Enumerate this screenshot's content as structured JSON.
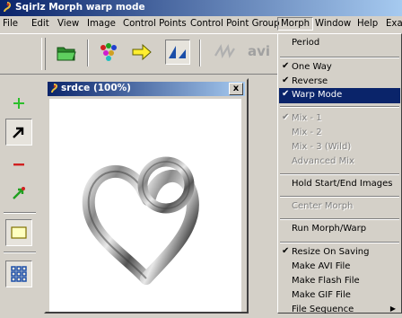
{
  "window": {
    "title": "Sqirlz Morph   warp mode"
  },
  "menubar": {
    "items": [
      "File",
      "Edit",
      "View",
      "Image",
      "Control Points",
      "Control Point Group",
      "Morph",
      "Window",
      "Help",
      "Exa"
    ],
    "open_item": "Morph"
  },
  "toolbar": {
    "buttons": [
      "open-folder-icon",
      "color-dots-icon",
      "arrow-right-icon",
      "warp-mode-icon",
      "wave-icon"
    ],
    "avi_label": "avi"
  },
  "left_tools": [
    "add-point-icon",
    "select-arrow-icon",
    "remove-point-icon",
    "move-point-icon",
    "rectangle-select-icon",
    "grid-icon"
  ],
  "child_window": {
    "title": "srdce (100%)",
    "close_label": "x",
    "image": "silver heart with ring"
  },
  "morph_menu": {
    "items": [
      {
        "label": "Period",
        "checked": false,
        "disabled": false
      },
      {
        "label": "One Way",
        "checked": true,
        "disabled": false
      },
      {
        "label": "Reverse",
        "checked": true,
        "disabled": false
      },
      {
        "label": "Warp Mode",
        "checked": true,
        "disabled": false,
        "selected": true
      },
      {
        "label": "Mix - 1",
        "checked": true,
        "disabled": true
      },
      {
        "label": "Mix - 2",
        "checked": false,
        "disabled": true
      },
      {
        "label": "Mix - 3 (Wild)",
        "checked": false,
        "disabled": true
      },
      {
        "label": "Advanced Mix",
        "checked": false,
        "disabled": true
      },
      {
        "label": "Hold Start/End Images",
        "checked": false,
        "disabled": false
      },
      {
        "label": "Center Morph",
        "checked": false,
        "disabled": true
      },
      {
        "label": "Run Morph/Warp",
        "checked": false,
        "disabled": false
      },
      {
        "label": "Resize On Saving",
        "checked": true,
        "disabled": false
      },
      {
        "label": "Make AVI File",
        "checked": false,
        "disabled": false
      },
      {
        "label": "Make Flash File",
        "checked": false,
        "disabled": false
      },
      {
        "label": "Make GIF File",
        "checked": false,
        "disabled": false
      },
      {
        "label": "File Sequence",
        "checked": false,
        "disabled": false,
        "submenu": true
      }
    ],
    "check_glyph": "✔",
    "submenu_glyph": "▶"
  }
}
